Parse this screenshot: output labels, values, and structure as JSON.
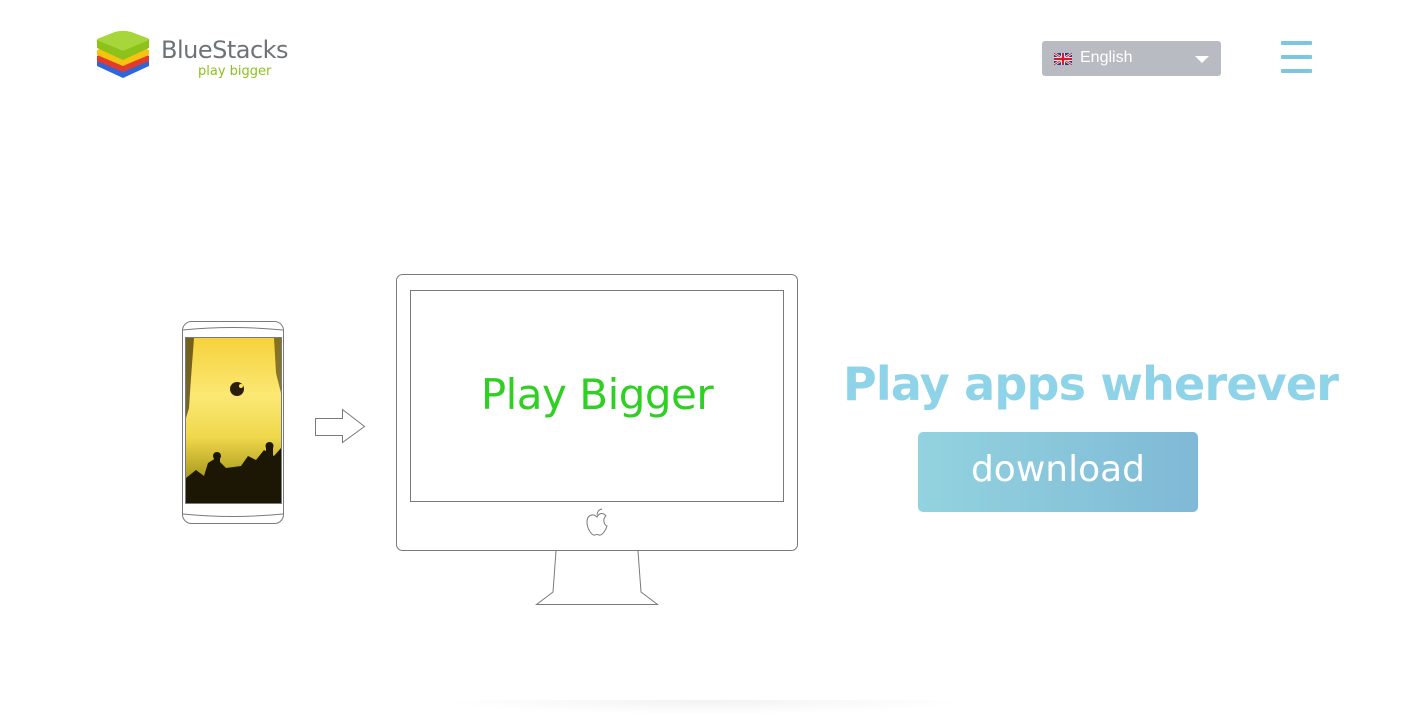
{
  "header": {
    "logo": {
      "name": "BlueStacks",
      "tagline": "play bigger"
    },
    "language": {
      "selected": "English",
      "flag_icon": "uk-flag-icon",
      "caret_icon": "caret-down-icon"
    },
    "menu_icon": "hamburger-menu-icon"
  },
  "hero": {
    "monitor_text": "Play Bigger",
    "headline": "Play apps wherever",
    "download_label": "download",
    "colors": {
      "headline": "#8fd3e8",
      "button_start": "#93d3df",
      "button_end": "#7fb9d6",
      "monitor_text": "#2fcf23",
      "logo_tagline": "#8cc21a",
      "language_bg": "#b8bcc2"
    },
    "icons": [
      "phone-illustration",
      "arrow-right-icon",
      "monitor-illustration",
      "apple-logo-icon"
    ]
  }
}
